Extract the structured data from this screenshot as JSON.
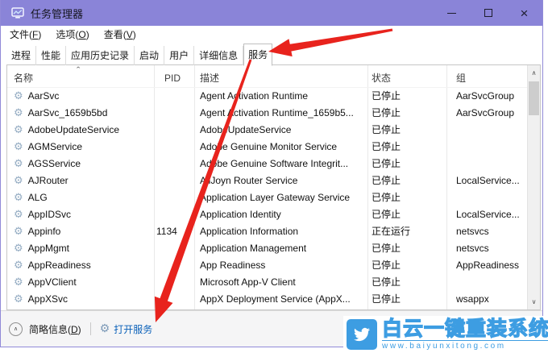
{
  "titlebar": {
    "title": "任务管理器"
  },
  "menu": {
    "items": [
      "文件(F)",
      "选项(O)",
      "查看(V)"
    ]
  },
  "tabs": {
    "items": [
      {
        "label": "进程"
      },
      {
        "label": "性能"
      },
      {
        "label": "应用历史记录"
      },
      {
        "label": "启动"
      },
      {
        "label": "用户"
      },
      {
        "label": "详细信息"
      },
      {
        "label": "服务"
      }
    ],
    "active": "服务"
  },
  "table": {
    "columns": [
      "名称",
      "PID",
      "描述",
      "状态",
      "组"
    ],
    "rows": [
      {
        "name": "AarSvc",
        "pid": "",
        "desc": "Agent Activation Runtime",
        "status": "已停止",
        "group": "AarSvcGroup"
      },
      {
        "name": "AarSvc_1659b5bd",
        "pid": "",
        "desc": "Agent Activation Runtime_1659b5...",
        "status": "已停止",
        "group": "AarSvcGroup"
      },
      {
        "name": "AdobeUpdateService",
        "pid": "",
        "desc": "AdobeUpdateService",
        "status": "已停止",
        "group": ""
      },
      {
        "name": "AGMService",
        "pid": "",
        "desc": "Adobe Genuine Monitor Service",
        "status": "已停止",
        "group": ""
      },
      {
        "name": "AGSService",
        "pid": "",
        "desc": "Adobe Genuine Software Integrit...",
        "status": "已停止",
        "group": ""
      },
      {
        "name": "AJRouter",
        "pid": "",
        "desc": "AllJoyn Router Service",
        "status": "已停止",
        "group": "LocalService..."
      },
      {
        "name": "ALG",
        "pid": "",
        "desc": "Application Layer Gateway Service",
        "status": "已停止",
        "group": ""
      },
      {
        "name": "AppIDSvc",
        "pid": "",
        "desc": "Application Identity",
        "status": "已停止",
        "group": "LocalService..."
      },
      {
        "name": "Appinfo",
        "pid": "1134",
        "desc": "Application Information",
        "status": "正在运行",
        "group": "netsvcs"
      },
      {
        "name": "AppMgmt",
        "pid": "",
        "desc": "Application Management",
        "status": "已停止",
        "group": "netsvcs"
      },
      {
        "name": "AppReadiness",
        "pid": "",
        "desc": "App Readiness",
        "status": "已停止",
        "group": "AppReadiness"
      },
      {
        "name": "AppVClient",
        "pid": "",
        "desc": "Microsoft App-V Client",
        "status": "已停止",
        "group": ""
      },
      {
        "name": "AppXSvc",
        "pid": "",
        "desc": "AppX Deployment Service (AppX...",
        "status": "已停止",
        "group": "wsappx"
      }
    ]
  },
  "footer": {
    "summary_label": "简略信息(D)",
    "open_services_label": "打开服务"
  },
  "watermark": {
    "brand": "白云一键重装系统",
    "url": "www.baiyunxitong.com"
  },
  "icons": {
    "gear": "⚙",
    "sort_ascending": "ˆ",
    "scroll_up": "∧",
    "scroll_down": "∨",
    "collapse_up": "∧"
  },
  "colors": {
    "titlebar_purple": "#8a84d8",
    "annotation_arrow_red": "#e8231d",
    "link_blue": "#0b61b9",
    "watermark_blue": "#3d9de2"
  }
}
